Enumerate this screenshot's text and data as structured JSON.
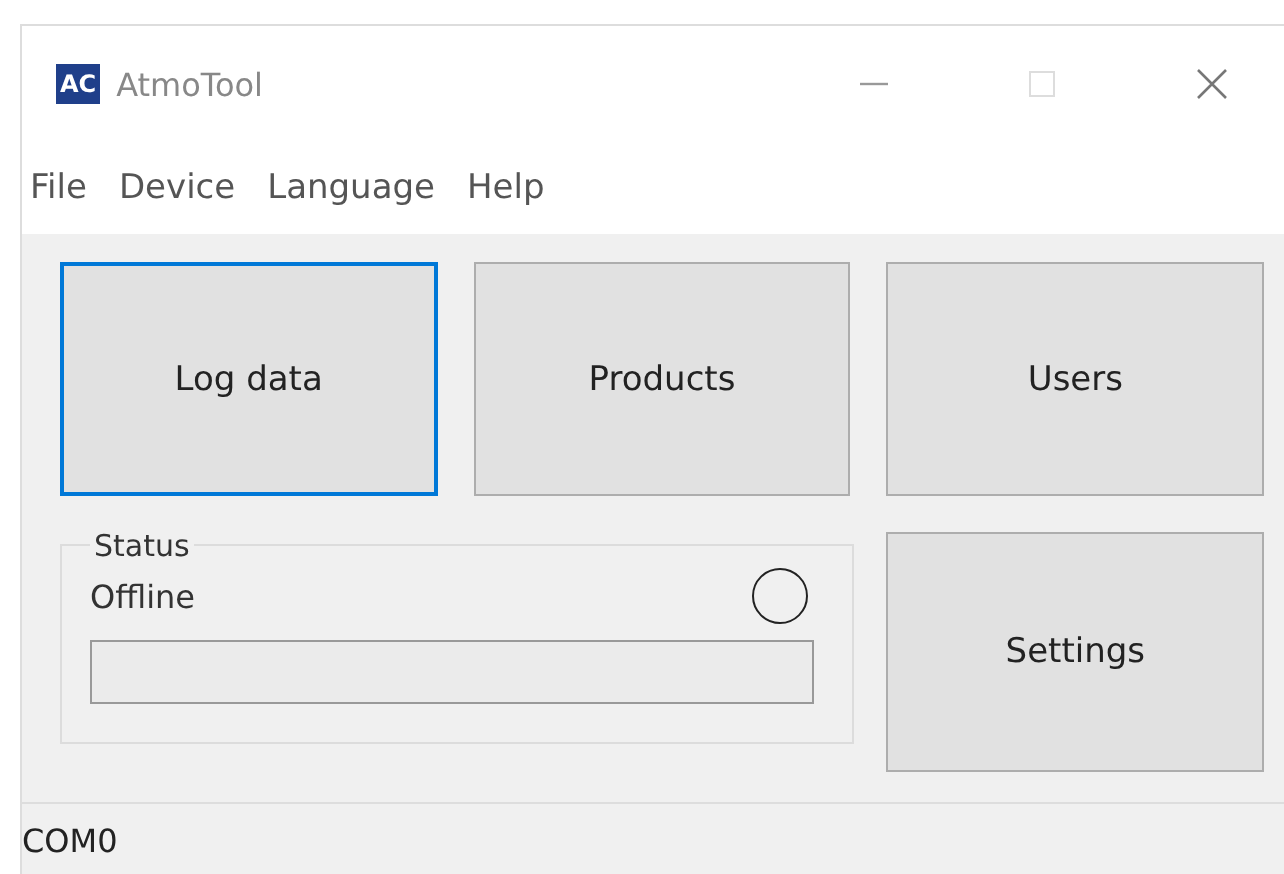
{
  "window": {
    "logo": "AC",
    "title": "AtmoTool",
    "controls": [
      {
        "kind": "minimize"
      },
      {
        "kind": "maximize"
      },
      {
        "kind": "close"
      }
    ]
  },
  "menu": [
    "File",
    "Device",
    "Language",
    "Help"
  ],
  "buttons": [
    {
      "label": "Log data",
      "focused": true
    },
    {
      "label": "Products",
      "focused": false
    },
    {
      "label": "Users",
      "focused": false
    }
  ],
  "status": {
    "title": "Status",
    "value": "Offline",
    "connected": false,
    "progress": {
      "level": 0
    }
  },
  "settings_button": {
    "label": "Settings",
    "focused": false
  },
  "status_bar": "COM0"
}
